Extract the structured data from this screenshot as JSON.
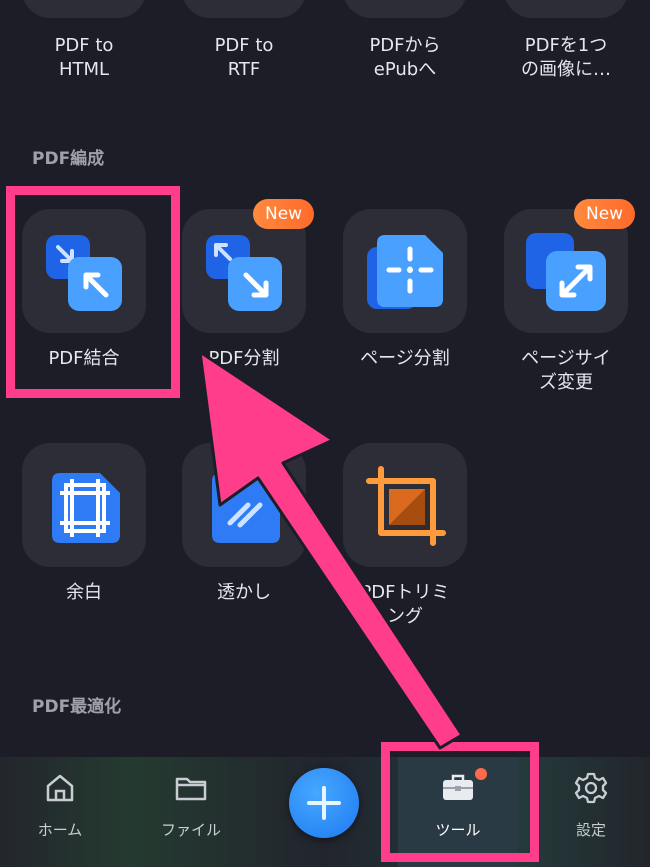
{
  "top_row": [
    {
      "label": "PDF to\nHTML"
    },
    {
      "label": "PDF to\nRTF"
    },
    {
      "label": "PDFから\nePubへ"
    },
    {
      "label": "PDFを1つ\nの画像に…"
    }
  ],
  "sections": {
    "edit_title": "PDF編成",
    "optimize_title": "PDF最適化"
  },
  "edit_tools": [
    {
      "label": "PDF結合"
    },
    {
      "label": "PDF分割",
      "badge": "New"
    },
    {
      "label": "ページ分割"
    },
    {
      "label": "ページサイ\nズ変更",
      "badge": "New"
    },
    {
      "label": "余白"
    },
    {
      "label": "透かし"
    },
    {
      "label": "PDFトリミ\nング"
    }
  ],
  "tabbar": {
    "items": [
      {
        "label": "ホーム",
        "icon": "home-icon"
      },
      {
        "label": "ファイル",
        "icon": "folder-icon"
      },
      {
        "label": "ツール",
        "icon": "toolbox-icon",
        "notification_dot": true
      },
      {
        "label": "設定",
        "icon": "gear-icon"
      }
    ],
    "fab_icon": "plus-icon"
  },
  "colors": {
    "background": "#1c1d26",
    "tile": "#2c2d36",
    "accent_blue": "#2f8bff",
    "badge_orange": "#ff7a33",
    "highlight_pink": "#ff3d8b"
  }
}
